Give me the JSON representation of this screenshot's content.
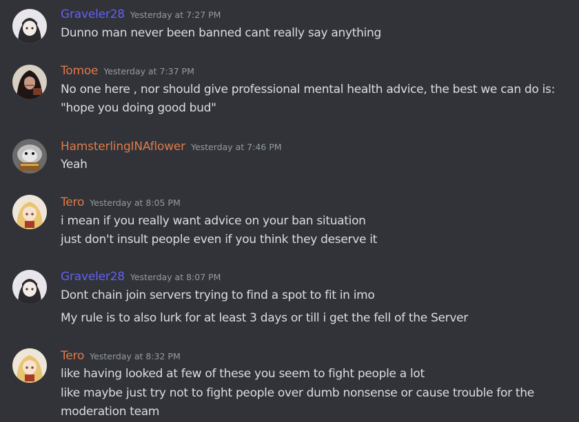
{
  "colors": {
    "background": "#313338",
    "text": "#dbdee1",
    "timestamp": "#949ba4",
    "name_blue": "#6261f3",
    "name_orange": "#e07a4a"
  },
  "messages": [
    {
      "username": "Graveler28",
      "name_color": "#6261f3",
      "timestamp": "Yesterday at 7:27 PM",
      "avatar": "dark-haired-girl-avatar",
      "lines": [
        "Dunno man never been banned cant really say anything"
      ]
    },
    {
      "username": "Tomoe",
      "name_color": "#e07a4a",
      "timestamp": "Yesterday at 7:37 PM",
      "avatar": "dark-hooded-figure-avatar",
      "lines": [
        "No one here , nor should give professional mental health advice, the best we can do is:",
        "\"hope you doing good bud\""
      ]
    },
    {
      "username": "HamsterlingINAflower",
      "name_color": "#e07a4a",
      "timestamp": "Yesterday at 7:46 PM",
      "avatar": "grey-hamster-avatar",
      "lines": [
        "Yeah"
      ]
    },
    {
      "username": "Tero",
      "name_color": "#e07a4a",
      "timestamp": "Yesterday at 8:05 PM",
      "avatar": "blonde-girl-avatar",
      "lines": [
        "i mean if you really want advice on your ban situation",
        "just don't insult people even if you think they deserve it"
      ]
    },
    {
      "username": "Graveler28",
      "name_color": "#6261f3",
      "timestamp": "Yesterday at 8:07 PM",
      "avatar": "dark-haired-girl-avatar",
      "lines": [
        "Dont chain join servers trying to find a spot to fit in imo",
        "My rule is to also lurk for at least 3 days or till i get the fell of the Server"
      ]
    },
    {
      "username": "Tero",
      "name_color": "#e07a4a",
      "timestamp": "Yesterday at 8:32 PM",
      "avatar": "blonde-girl-avatar",
      "lines": [
        "like having looked at few of these you seem to fight people a lot",
        "like maybe just try not to fight people over dumb nonsense or cause trouble for the",
        "moderation team"
      ]
    }
  ]
}
